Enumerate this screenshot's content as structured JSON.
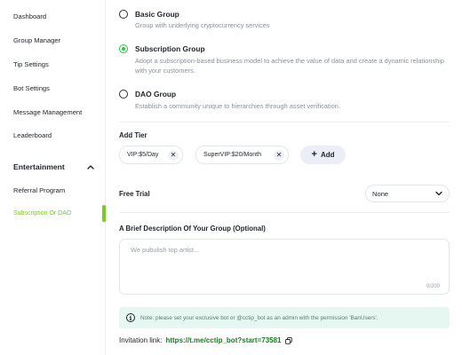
{
  "sidebar": {
    "items": [
      {
        "label": "Dashboard"
      },
      {
        "label": "Group Manager"
      },
      {
        "label": "Tip Settings"
      },
      {
        "label": "Bot Settings"
      },
      {
        "label": "Message Management"
      },
      {
        "label": "Leaderboard"
      }
    ],
    "section": {
      "label": "Entertainment",
      "icon": "chevron-up-icon",
      "expanded": true
    },
    "sub_items": [
      {
        "label": "Referral Program",
        "active": false
      },
      {
        "label": "Subscription Or DAO",
        "active": true
      }
    ],
    "accent_color": "#7ccc1e"
  },
  "group_type": {
    "options": [
      {
        "title": "Basic Group",
        "description": "Group with underlying cryptocurrency services",
        "selected": false
      },
      {
        "title": "Subscription Group",
        "description": "Adopt a subscription-based business model to achieve the value of data and create a dynamic relationship with your customers.",
        "selected": true
      },
      {
        "title": "DAO Group",
        "description": "Establish a community unique to hierarchies through asset verification.",
        "selected": false
      }
    ],
    "selected_color": "#27c93f"
  },
  "tiers": {
    "label": "Add Tier",
    "items": [
      {
        "label": "VIP:$5/Day"
      },
      {
        "label": "SuperVIP:$20/Month"
      }
    ],
    "remove_glyph": "✕",
    "add_label": "Add",
    "add_glyph": "+"
  },
  "free_trial": {
    "label": "Free Trial",
    "value": "None"
  },
  "description": {
    "label": "A Brief Description Of Your Group (Optional)",
    "placeholder": "We pubulish top artist...",
    "counter": "0/200"
  },
  "note": {
    "icon": "info-icon",
    "glyph": "i",
    "text": "Note: please set your exclusive bot or @cctip_bot as an admin with the permission 'BanUsers'.",
    "background": "#e6f7f1"
  },
  "invitation": {
    "label": "Invitation link:",
    "link": "https://t.me/cctip_bot?start=73581",
    "icon": "copy-icon"
  }
}
